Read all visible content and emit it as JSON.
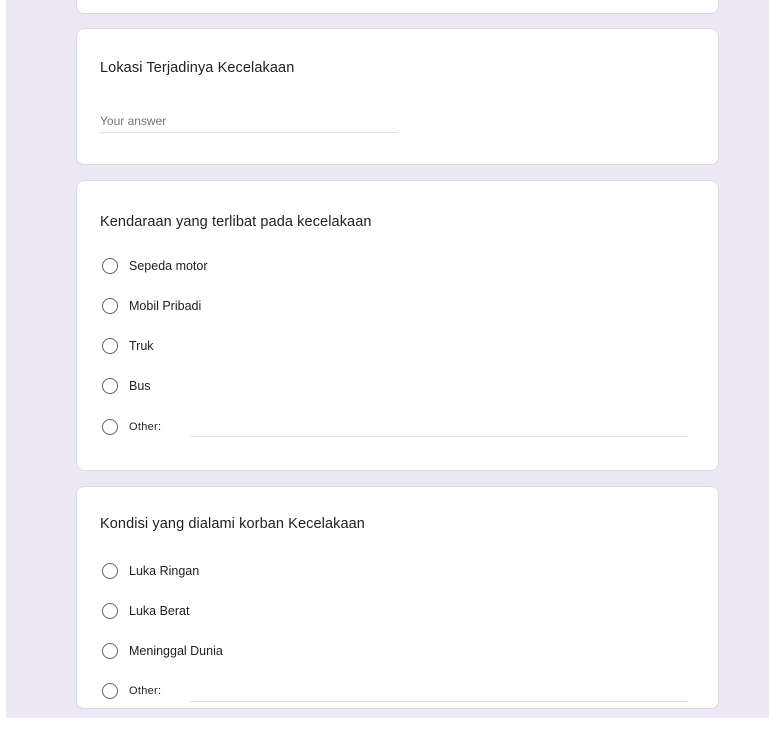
{
  "questions": [
    {
      "title": "Lokasi Terjadinya Kecelakaan",
      "answer_placeholder": "Your answer"
    },
    {
      "title": "Kendaraan yang terlibat pada kecelakaan",
      "options": [
        "Sepeda motor",
        "Mobil Pribadi",
        "Truk",
        "Bus",
        "Other:"
      ]
    },
    {
      "title": "Kondisi yang dialami korban Kecelakaan",
      "options": [
        "Luka Ringan",
        "Luka Berat",
        "Meninggal Dunia",
        "Other:"
      ]
    }
  ],
  "colors": {
    "page_background": "#ede7f6",
    "card_background": "#ffffff",
    "card_border": "#dadce0",
    "radio_border": "#5f6368"
  }
}
